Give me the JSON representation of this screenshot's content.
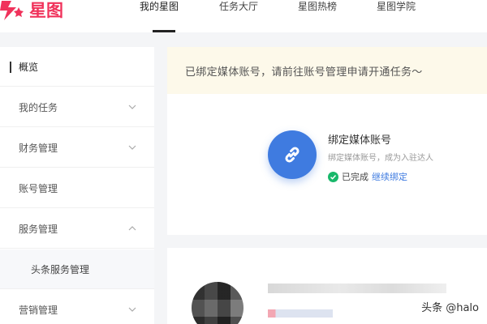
{
  "app": {
    "logo_text": "星图",
    "brand_color": "#f0325b",
    "accent_color": "#3f7be0"
  },
  "nav": {
    "items": [
      {
        "label": "我的星图",
        "active": true
      },
      {
        "label": "任务大厅",
        "active": false
      },
      {
        "label": "星图热榜",
        "active": false
      },
      {
        "label": "星图学院",
        "active": false
      }
    ]
  },
  "sidebar": {
    "items": [
      {
        "label": "概览",
        "active": true,
        "chevron": "none"
      },
      {
        "label": "我的任务",
        "chevron": "chevron-down-icon"
      },
      {
        "label": "财务管理",
        "chevron": "chevron-down-icon"
      },
      {
        "label": "账号管理",
        "chevron": "none"
      },
      {
        "label": "服务管理",
        "chevron": "chevron-up-icon"
      },
      {
        "label": "头条服务管理",
        "sub": true
      },
      {
        "label": "营销管理",
        "chevron": "chevron-down-icon"
      }
    ]
  },
  "notice": {
    "text": "已绑定媒体账号，请前往账号管理申请开通任务～"
  },
  "bind_card": {
    "icon": "link-icon",
    "title": "绑定媒体账号",
    "description": "绑定媒体账号，成为入驻达人",
    "status_icon": "check-circle-icon",
    "status_text": "已完成",
    "status_link": "继续绑定"
  },
  "watermark": "头条 @halo"
}
